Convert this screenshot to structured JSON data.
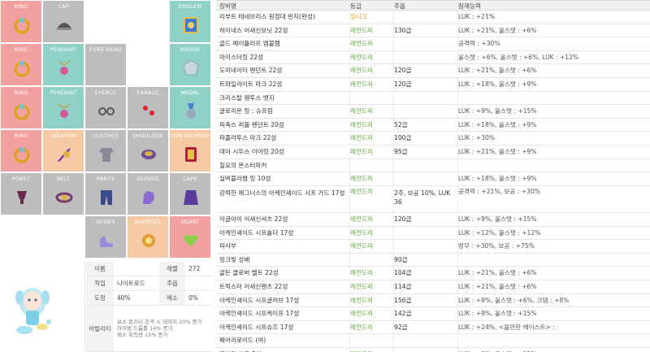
{
  "equipment_slots": [
    {
      "label": "RING",
      "bg": "#f2a0a0",
      "item": "ring-icon"
    },
    {
      "label": "CAP",
      "bg": "#bdbdbd",
      "item": "cap-icon"
    },
    {
      "label": "",
      "bg": "#ffffff",
      "item": ""
    },
    {
      "label": "",
      "bg": "#ffffff",
      "item": ""
    },
    {
      "label": "EMBLEM",
      "bg": "#8fd1c7",
      "item": "emblem-icon"
    },
    {
      "label": "RING",
      "bg": "#f2a0a0",
      "item": "ring-icon"
    },
    {
      "label": "PENDANT",
      "bg": "#8fd1c7",
      "item": "pendant-icon"
    },
    {
      "label": "FORE HEAD",
      "bg": "#bdbdbd",
      "item": ""
    },
    {
      "label": "",
      "bg": "#ffffff",
      "item": ""
    },
    {
      "label": "BADGE",
      "bg": "#8fd1c7",
      "item": "badge-icon"
    },
    {
      "label": "RING",
      "bg": "#f2a0a0",
      "item": "ring-icon"
    },
    {
      "label": "PENDANT",
      "bg": "#8fd1c7",
      "item": "pendant-icon"
    },
    {
      "label": "EYEACC",
      "bg": "#bdbdbd",
      "item": "eyeacc-icon"
    },
    {
      "label": "EARACC",
      "bg": "#bdbdbd",
      "item": "earacc-icon"
    },
    {
      "label": "MEDAL",
      "bg": "#8fd1c7",
      "item": "medal-icon"
    },
    {
      "label": "RING",
      "bg": "#f2a0a0",
      "item": "ring-icon"
    },
    {
      "label": "WEAPON",
      "bg": "#f5c9a3",
      "item": "weapon-icon"
    },
    {
      "label": "CLOTHES",
      "bg": "#bdbdbd",
      "item": "clothes-icon"
    },
    {
      "label": "SHOULDER",
      "bg": "#bdbdbd",
      "item": "shoulder-icon"
    },
    {
      "label": "SUB WEAPON",
      "bg": "#f5c9a3",
      "item": "subweapon-icon"
    },
    {
      "label": "POKET",
      "bg": "#bdbdbd",
      "item": "pocket-icon"
    },
    {
      "label": "BELT",
      "bg": "#bdbdbd",
      "item": "belt-icon"
    },
    {
      "label": "PANTS",
      "bg": "#bdbdbd",
      "item": "pants-icon"
    },
    {
      "label": "GLOVES",
      "bg": "#bdbdbd",
      "item": "gloves-icon"
    },
    {
      "label": "CAPE",
      "bg": "#bdbdbd",
      "item": "cape-icon"
    },
    {
      "label": "",
      "bg": "#ffffff",
      "item": ""
    },
    {
      "label": "",
      "bg": "#ffffff",
      "item": ""
    },
    {
      "label": "SHOES",
      "bg": "#bdbdbd",
      "item": "shoes-icon"
    },
    {
      "label": "ANDROID",
      "bg": "#f5c9a3",
      "item": "android-icon"
    },
    {
      "label": "HEART",
      "bg": "#f2a0a0",
      "item": "heart-icon"
    }
  ],
  "character": {
    "rows": [
      {
        "k1": "이름",
        "v1": "",
        "k2": "레벨",
        "v2": "272"
      },
      {
        "k1": "직업",
        "v1": "나이트로드",
        "k2": "추옵",
        "v2": ""
      },
      {
        "k1": "도핑",
        "v1": "40%",
        "k2": "메소",
        "v2": "0%"
      }
    ],
    "ability_label": "어빌리티",
    "ability_lines": [
      "보스 몬스터 공격 시 데미지 20% 증가",
      "아이템 드롭률 14% 증가",
      "메소 획득량 15% 증가"
    ]
  },
  "table": {
    "headers": {
      "name": "장비명",
      "grade": "등급",
      "star": "추옵",
      "pot": "잠재능력"
    },
    "rows": [
      {
        "name": "리부트 테네브리스 원정대 반지(완성)",
        "grade": "유니크",
        "star": "",
        "pot": "LUK : +21%",
        "unique": true
      },
      {
        "name": "하이네스 어새신보닛 22성",
        "grade": "레전드리",
        "star": "130급",
        "pot": "LUK : +21%, 올스탯 : +6%"
      },
      {
        "name": "골드 메이플리프 엠블렘",
        "grade": "레전드리",
        "star": "",
        "pot": "공격력 : +30%"
      },
      {
        "name": "마이스터링 22성",
        "grade": "레전드리",
        "star": "",
        "pot": "올스탯 : +6%, 올스탯 : +6%, LUK : +12%"
      },
      {
        "name": "도미네이터 펜던트 22성",
        "grade": "레전드리",
        "star": "120급",
        "pot": "LUK : +21%, 올스탯 : +6%"
      },
      {
        "name": "트와일라이트 마크 22성",
        "grade": "레전드리",
        "star": "120급",
        "pot": "LUK : +18%, 올스탯 : +9%"
      },
      {
        "name": "크리스탈 웬투스 뱃지",
        "grade": "",
        "star": "",
        "pot": ""
      },
      {
        "name": "글로리온 링 : 슈프림",
        "grade": "레전드리",
        "star": "",
        "pot": "LUK : +9%, 올스탯 : +15%"
      },
      {
        "name": "피축스 퍼플 펜던트 20성",
        "grade": "레전드리",
        "star": "52급",
        "pot": "LUK : +18%, 올스탯 : +9%"
      },
      {
        "name": "파풀라투스 마크 22성",
        "grade": "레전드리",
        "star": "100급",
        "pot": "LUK : +30%"
      },
      {
        "name": "데아 시두스 이어링 20성",
        "grade": "레전드리",
        "star": "95급",
        "pot": "LUK : +21%, 올스탯 : +9%"
      },
      {
        "name": "칠요의 몬스터파커",
        "grade": "",
        "star": "",
        "pot": ""
      },
      {
        "name": "실버블라썸 링 10성",
        "grade": "레전드리",
        "star": "",
        "pot": "LUK : +18%, 올스탯 : +9%"
      },
      {
        "name": "강력한 매그너스의 아케인셰이드 시프 가드 17성",
        "name2": "아케인셰이드 시프가드 17성",
        "grade": "레전드리",
        "star": "2추, 보공 10%, LUK 36",
        "pot": "공격력 : +21%, 보공 : +30%",
        "tall": true
      },
      {
        "name": "이글아이 어새신셔츠 22성",
        "grade": "레전드리",
        "star": "120급",
        "pot": "LUK : +9%, 올스탯 : +15%"
      },
      {
        "name": "아케인셰이드 시프숄더 17성",
        "grade": "레전드리",
        "star": "",
        "pot": "LUK : +12%, 올스탯 : +12%"
      },
      {
        "name": "파사부",
        "grade": "레전드리",
        "star": "",
        "pot": "방무 : +30%, 보공 : +75%"
      },
      {
        "name": "핑크빛 성배",
        "grade": "",
        "star": "90급",
        "pot": ""
      },
      {
        "name": "골든 클로버 벨트 22성",
        "grade": "레전드리",
        "star": "104급",
        "pot": "LUK : +21%, 올스탯 : +6%"
      },
      {
        "name": "트릭스터 어새신팬츠 22성",
        "grade": "레전드리",
        "star": "114급",
        "pot": "LUK : +21%, 올스탯 : +6%"
      },
      {
        "name": "아케인셰이드 시프글러브 17성",
        "grade": "레전드리",
        "star": "156급",
        "pot": "LUK : +9%, 올스탯 : +6%, 크뎀 : +8%"
      },
      {
        "name": "아케인셰이드 시프케이프 17성",
        "grade": "레전드리",
        "star": "142급",
        "pot": "LUK : +9%, 올스탯 : +15%"
      },
      {
        "name": "아케인셰이드 시프슈즈 17성",
        "grade": "레전드리",
        "star": "92급",
        "pot": "LUK : +24%, <쓸만한 헤이스트> :"
      },
      {
        "name": "페어리로이드 (여)",
        "grade": "",
        "star": "",
        "pot": ""
      },
      {
        "name": "페어리 하트 8성",
        "grade": "레전드리",
        "star": "",
        "pot": "LUK : +9%, 올스탯 : +15%"
      }
    ]
  }
}
